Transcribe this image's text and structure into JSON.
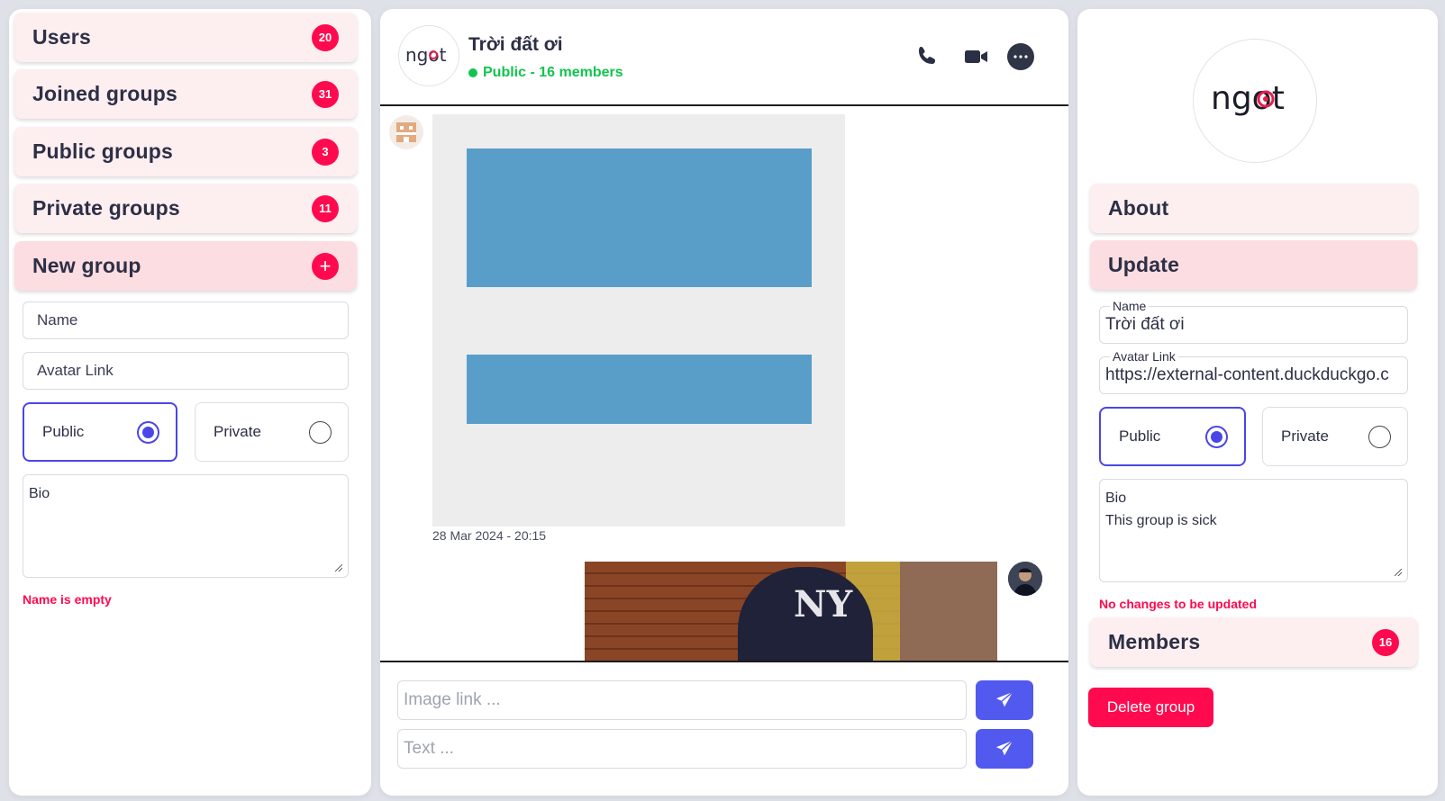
{
  "sidebar": {
    "items": [
      {
        "label": "Users",
        "badge": "20"
      },
      {
        "label": "Joined groups",
        "badge": "31"
      },
      {
        "label": "Public groups",
        "badge": "3"
      },
      {
        "label": "Private groups",
        "badge": "11"
      },
      {
        "label": "New group",
        "badge": "+"
      }
    ]
  },
  "new_group_form": {
    "name_placeholder": "Name",
    "avatar_placeholder": "Avatar Link",
    "public_label": "Public",
    "private_label": "Private",
    "selected_visibility": "Public",
    "bio_placeholder": "Bio",
    "error": "Name is empty"
  },
  "chat": {
    "logo_text": "ngot",
    "title": "Trời đất ơi",
    "status": "Public - 16 members",
    "icons": [
      "phone-icon",
      "video-icon",
      "more-icon"
    ],
    "messages": [
      {
        "type": "image",
        "timestamp": "28 Mar 2024 - 20:15",
        "sender": "other"
      },
      {
        "type": "image",
        "sender": "self",
        "image_caption": "NY"
      }
    ],
    "image_link_placeholder": "Image link ...",
    "text_placeholder": "Text ..."
  },
  "group_details": {
    "logo_text": "ngot",
    "sections": [
      "About",
      "Update"
    ],
    "name_label": "Name",
    "name_value": "Trời đất ơi",
    "avatar_label": "Avatar Link",
    "avatar_value": "https://external-content.duckduckgo.c",
    "public_label": "Public",
    "private_label": "Private",
    "selected_visibility": "Public",
    "bio_label": "Bio",
    "bio_value": "This group is sick",
    "error": "No changes to be updated",
    "members_label": "Members",
    "members_count": "16",
    "delete_label": "Delete group"
  },
  "colors": {
    "accent": "#ff0a4e",
    "primary": "#5159ef",
    "online": "#12c44e",
    "card_bg": "#fdeef0"
  }
}
